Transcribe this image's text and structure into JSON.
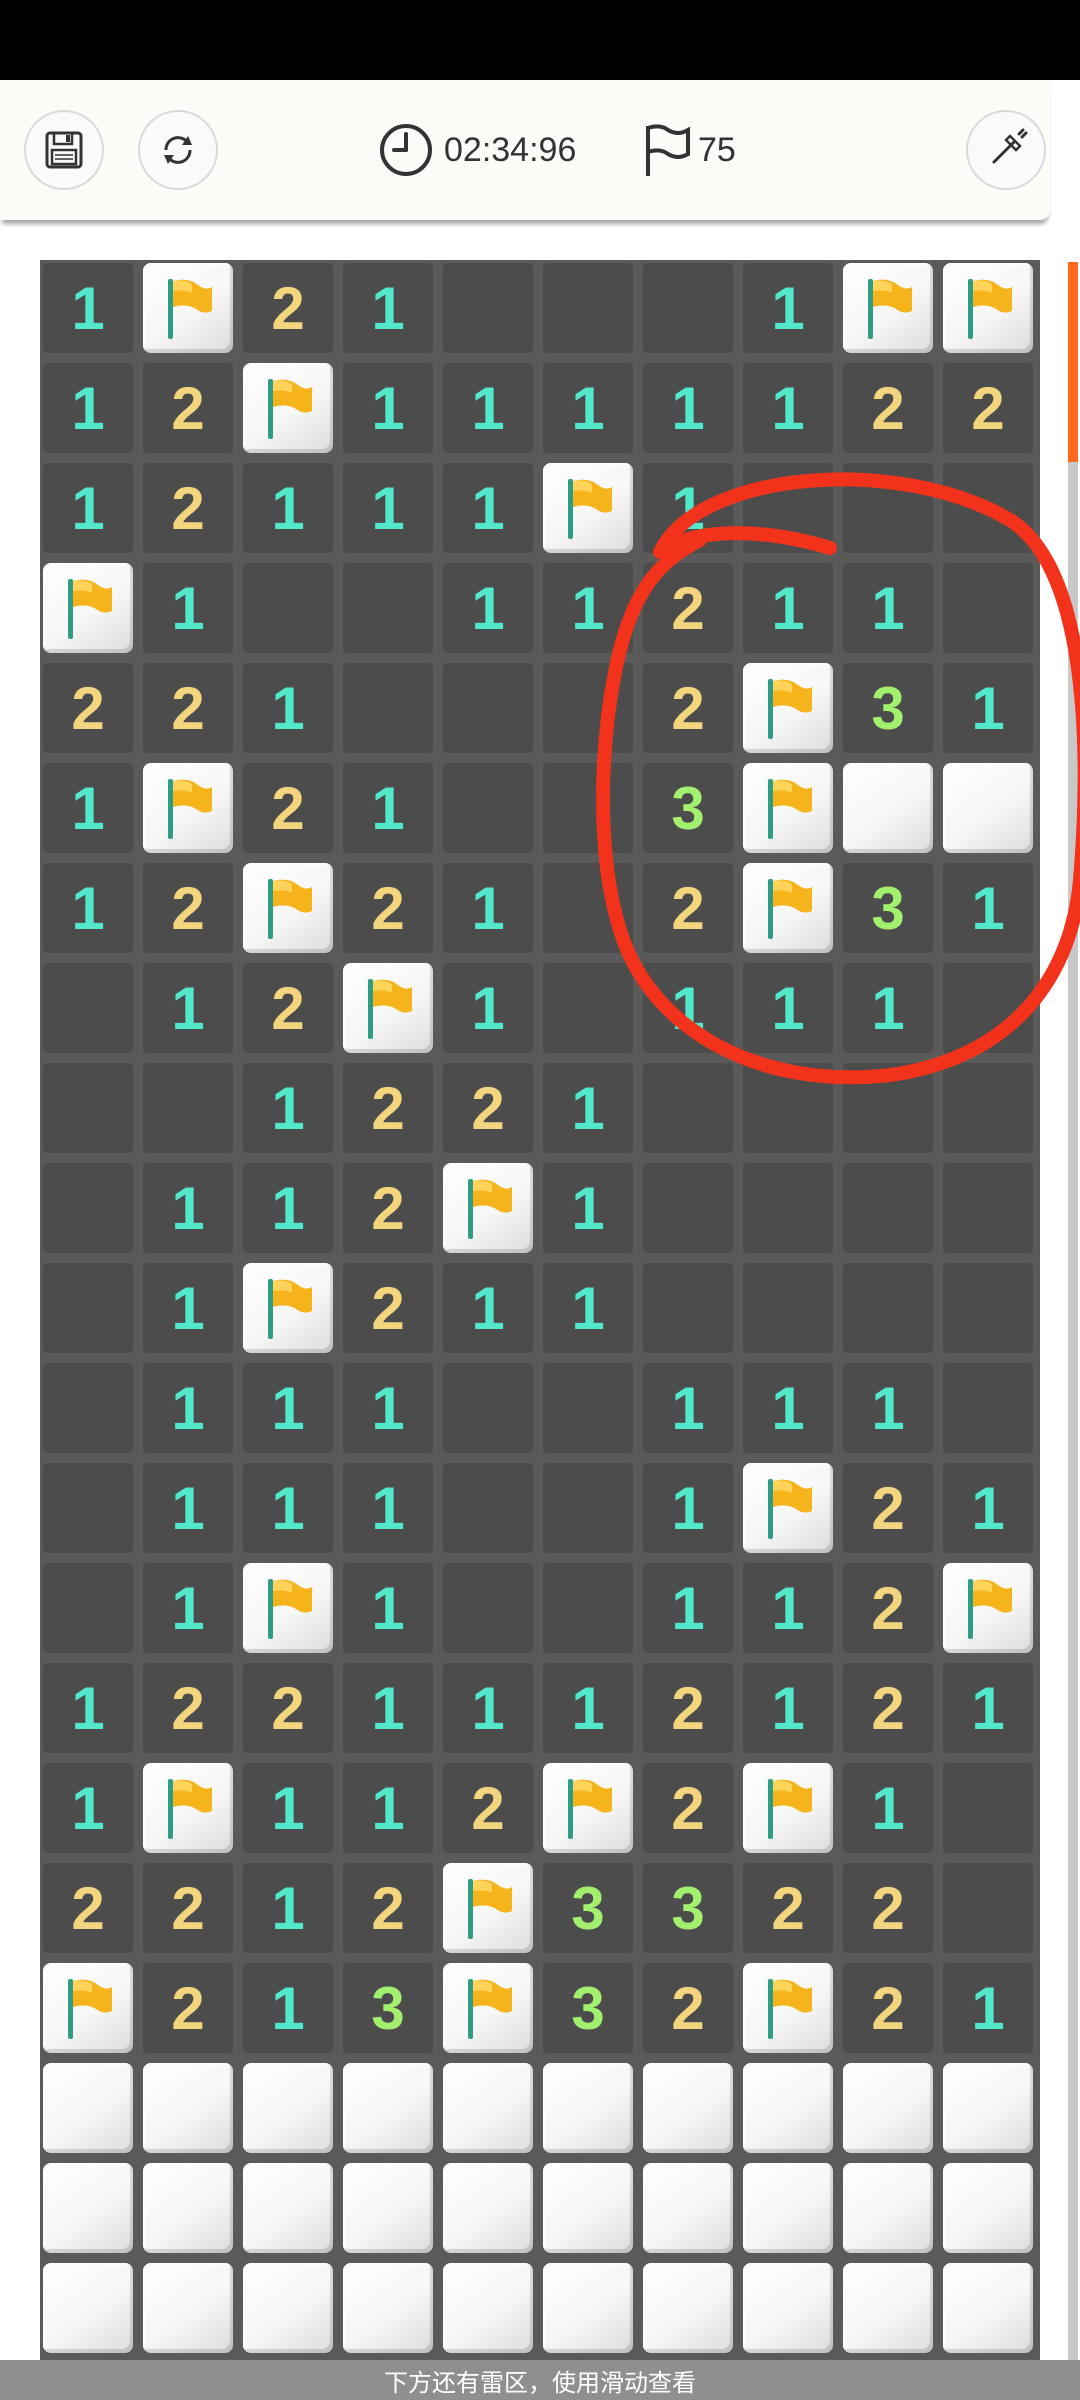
{
  "toolbar": {
    "icons": [
      "save-icon",
      "restart-icon",
      "clock-icon",
      "flag-icon",
      "shovel-icon"
    ],
    "timer": "02:34:96",
    "flags_count": "75"
  },
  "board": {
    "columns": 10,
    "legend": {
      "F": "flagged",
      "C": "covered",
      "0": "empty",
      "1-3": "adjacent mine count"
    },
    "number_colors": {
      "1": "#52e8cc",
      "2": "#f3d57e",
      "3": "#a3ef6e"
    },
    "rows": [
      [
        "1",
        "F",
        "2",
        "1",
        "0",
        "0",
        "0",
        "1",
        "F",
        "F"
      ],
      [
        "1",
        "2",
        "F",
        "1",
        "1",
        "1",
        "1",
        "1",
        "2",
        "2"
      ],
      [
        "1",
        "2",
        "1",
        "1",
        "1",
        "F",
        "1",
        "0",
        "0",
        "0"
      ],
      [
        "F",
        "1",
        "0",
        "0",
        "1",
        "1",
        "2",
        "1",
        "1",
        "0"
      ],
      [
        "2",
        "2",
        "1",
        "0",
        "0",
        "0",
        "2",
        "F",
        "3",
        "1"
      ],
      [
        "1",
        "F",
        "2",
        "1",
        "0",
        "0",
        "3",
        "F",
        "C",
        "C"
      ],
      [
        "1",
        "2",
        "F",
        "2",
        "1",
        "0",
        "2",
        "F",
        "3",
        "1"
      ],
      [
        "0",
        "1",
        "2",
        "F",
        "1",
        "0",
        "1",
        "1",
        "1",
        "0"
      ],
      [
        "0",
        "0",
        "1",
        "2",
        "2",
        "1",
        "0",
        "0",
        "0",
        "0"
      ],
      [
        "0",
        "1",
        "1",
        "2",
        "F",
        "1",
        "0",
        "0",
        "0",
        "0"
      ],
      [
        "0",
        "1",
        "F",
        "2",
        "1",
        "1",
        "0",
        "0",
        "0",
        "0"
      ],
      [
        "0",
        "1",
        "1",
        "1",
        "0",
        "0",
        "1",
        "1",
        "1",
        "0"
      ],
      [
        "0",
        "1",
        "1",
        "1",
        "0",
        "0",
        "1",
        "F",
        "2",
        "1"
      ],
      [
        "0",
        "1",
        "F",
        "1",
        "0",
        "0",
        "1",
        "1",
        "2",
        "F"
      ],
      [
        "1",
        "2",
        "2",
        "1",
        "1",
        "1",
        "2",
        "1",
        "2",
        "1"
      ],
      [
        "1",
        "F",
        "1",
        "1",
        "2",
        "F",
        "2",
        "F",
        "1",
        "0"
      ],
      [
        "2",
        "2",
        "1",
        "2",
        "F",
        "3",
        "3",
        "2",
        "2",
        "0"
      ],
      [
        "F",
        "2",
        "1",
        "3",
        "F",
        "3",
        "2",
        "F",
        "2",
        "1"
      ],
      [
        "C",
        "C",
        "C",
        "C",
        "C",
        "C",
        "C",
        "C",
        "C",
        "C"
      ],
      [
        "C",
        "C",
        "C",
        "C",
        "C",
        "C",
        "C",
        "C",
        "C",
        "C"
      ],
      [
        "C",
        "C",
        "C",
        "C",
        "C",
        "C",
        "C",
        "C",
        "C",
        "C"
      ]
    ]
  },
  "annotation": {
    "shape": "hand-drawn-circle",
    "color": "#f2321a"
  },
  "hint": {
    "text": "下方还有雷区，使用滑动查看"
  }
}
